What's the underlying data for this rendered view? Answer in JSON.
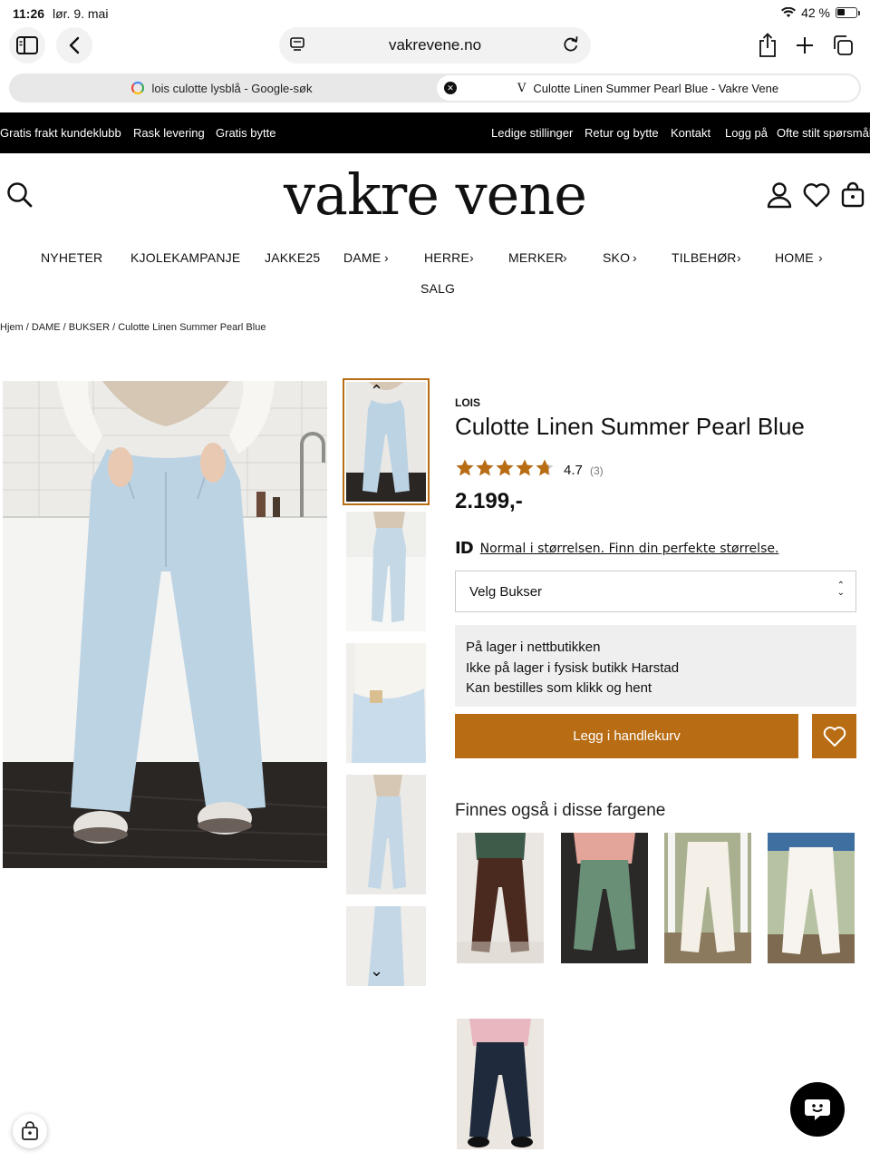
{
  "status": {
    "time": "11:26",
    "date": "lør. 9. mai",
    "battery": "42 %"
  },
  "browser": {
    "url": "vakrevene.no",
    "tabs": [
      {
        "label": "lois culotte lysblå - Google-søk"
      },
      {
        "label": "Culotte Linen Summer Pearl Blue - Vakre Vene"
      }
    ]
  },
  "promo": {
    "left": [
      "Gratis frakt kundeklubb",
      "Rask levering",
      "Gratis bytte"
    ],
    "right": [
      "Ledige stillinger",
      "Retur og bytte",
      "Kontakt",
      "Logg på",
      "Ofte stilt spørsmål"
    ]
  },
  "site": {
    "logo": "vakre vene"
  },
  "nav": {
    "items": [
      {
        "label": "NYHETER"
      },
      {
        "label": "KJOLEKAMPANJE"
      },
      {
        "label": "JAKKE25"
      },
      {
        "label": "DAME"
      },
      {
        "label": "HERRE"
      },
      {
        "label": "MERKER"
      },
      {
        "label": "SKO"
      },
      {
        "label": "TILBEHØR"
      },
      {
        "label": "HOME"
      },
      {
        "label": "SALG"
      }
    ]
  },
  "breadcrumb": "Hjem / DAME / BUKSER / Culotte Linen Summer Pearl Blue",
  "product": {
    "brand": "LOIS",
    "title": "Culotte Linen Summer Pearl Blue",
    "rating": "4.7",
    "rating_count": "(3)",
    "rating_value": 4.7,
    "price": "2.199,-",
    "size_hint_logo": "ID",
    "size_hint": "Normal i størrelsen. Finn din perfekte størrelse.",
    "size_select": "Velg Bukser",
    "stock": [
      "På lager i nettbutikken",
      "Ikke på lager i fysisk butikk Harstad",
      "Kan bestilles som klikk og hent"
    ],
    "add_to_cart": "Legg i handlekurv"
  },
  "colors": {
    "heading": "Finnes også i disse fargene"
  },
  "theme": {
    "accent": "#b86d14",
    "promo_bg": "#000000"
  }
}
